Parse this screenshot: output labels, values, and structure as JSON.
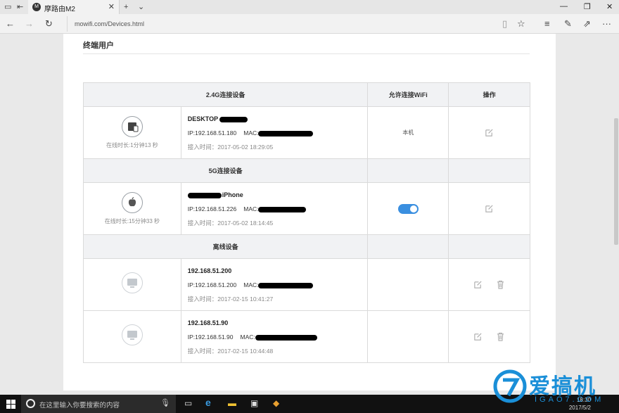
{
  "browser": {
    "tab_title": "摩路由M2",
    "url": "mowifi.com/Devices.html",
    "favicon": "moto-logo-icon"
  },
  "page": {
    "section_title": "终端用户"
  },
  "table": {
    "headers": {
      "devices_24g": "2.4G连接设备",
      "allow_wifi": "允许连接WiFi",
      "actions": "操作",
      "devices_5g": "5G连接设备",
      "offline": "离线设备"
    },
    "devices_24g": [
      {
        "icon": "device-icon",
        "online": "在线时长:1分钟13 秒",
        "name": "DESKTOP",
        "ip": "IP:192.168.51.180",
        "mac_label": "MAC:",
        "joined": "接入时间：2017-05-02 18:29:05",
        "wifi": "本机"
      }
    ],
    "devices_5g": [
      {
        "icon": "apple-icon",
        "online": "在线时长:15分钟33 秒",
        "name": "iPhone",
        "ip": "IP:192.168.51.226",
        "mac_label": "MAC:",
        "joined": "接入时间：2017-05-02 18:14:45",
        "wifi_enabled": true
      }
    ],
    "offline": [
      {
        "icon": "monitor-icon",
        "name": "192.168.51.200",
        "ip": "IP:192.168.51.200",
        "mac_label": "MAC:",
        "joined": "接入时间：2017-02-15 10:41:27"
      },
      {
        "icon": "monitor-icon",
        "name": "192.168.51.90",
        "ip": "IP:192.168.51.90",
        "mac_label": "MAC:",
        "joined": "接入时间：2017-02-15 10:44:48"
      }
    ]
  },
  "taskbar": {
    "search_placeholder": "在这里输入你要搜索的内容",
    "time": "18:30",
    "date": "2017/5/2"
  },
  "watermark": {
    "brand": "爱搞机",
    "site": "IGAO7.COM"
  },
  "colors": {
    "toggle_on": "#3a8fe0",
    "header_bg": "#f1f2f4",
    "watermark": "#1a8fd8"
  }
}
